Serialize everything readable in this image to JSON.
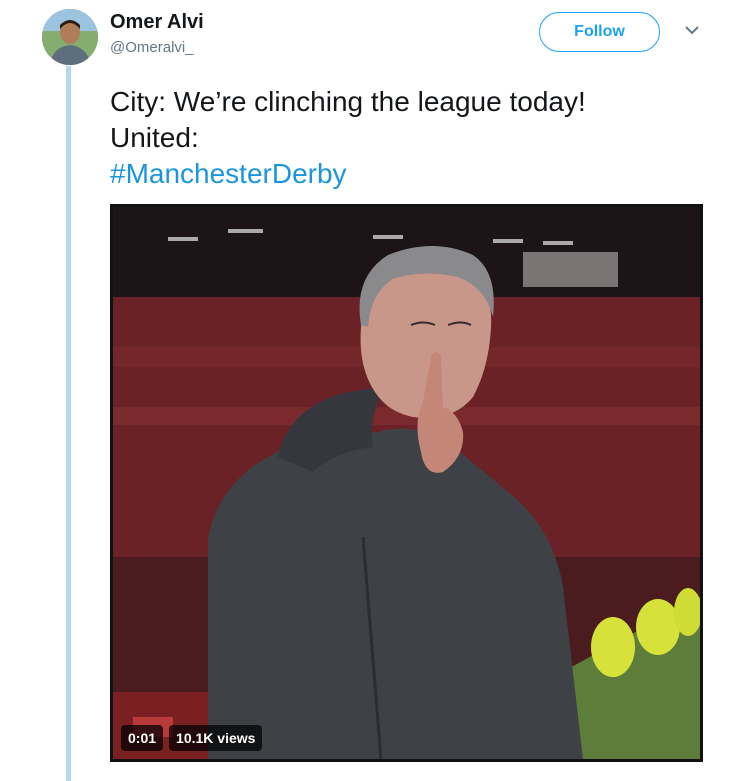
{
  "tweet": {
    "author_name": "Omer Alvi",
    "author_handle": "@Omeralvi_",
    "follow_label": "Follow",
    "lines": [
      "City: We’re clinching the league today!",
      "United:"
    ],
    "hashtag": "#ManchesterDerby"
  },
  "video": {
    "elapsed": "0:01",
    "views": "10.1K views"
  },
  "colors": {
    "accent": "#1da1f2",
    "hashtag": "#1b95e0",
    "thread_line": "#b5dbe8"
  }
}
